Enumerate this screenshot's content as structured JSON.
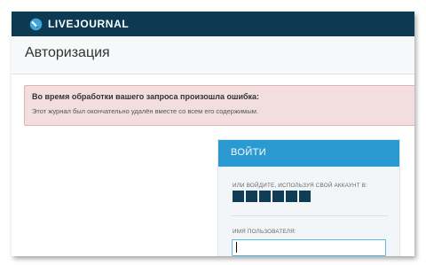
{
  "header": {
    "logo_text": "LIVEJOURNAL"
  },
  "page": {
    "title": "Авторизация"
  },
  "error": {
    "title": "Во время обработки вашего запроса произошла ошибка:",
    "message": "Этот журнал был окончательно удалён вместе со всем его содержимым."
  },
  "login": {
    "header_label": "ВОЙТИ",
    "social_label": "ИЛИ ВОЙДИТЕ, ИСПОЛЬЗУЯ СВОЙ АККАУНТ В:",
    "social_buttons": [
      "social-1",
      "social-2",
      "social-3",
      "social-4",
      "social-5",
      "social-6"
    ],
    "username_label": "ИМЯ ПОЛЬЗОВАТЕЛЯ:",
    "username_value": ""
  },
  "colors": {
    "topbar": "#0b3a52",
    "login_header": "#2a9ad1",
    "error_bg": "#f2dede",
    "input_border": "#5bb8e6"
  }
}
